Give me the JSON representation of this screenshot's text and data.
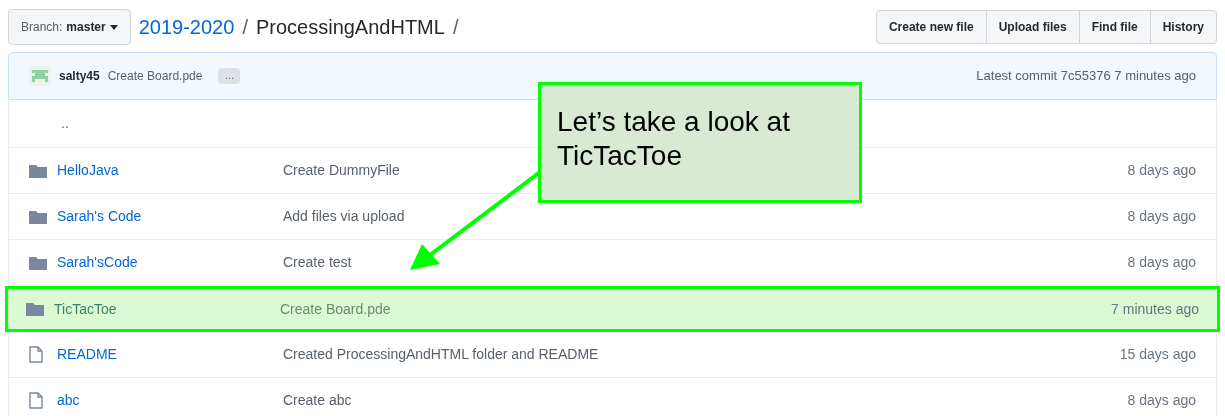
{
  "branch": {
    "label": "Branch:",
    "value": "master"
  },
  "breadcrumb": {
    "parent": "2019-2020",
    "current": "ProcessingAndHTML",
    "separator": "/"
  },
  "actions": [
    "Create new file",
    "Upload files",
    "Find file",
    "History"
  ],
  "commit": {
    "author": "salty45",
    "message": "Create Board.pde",
    "more": "…",
    "latest": "Latest commit 7c55376 7 minutes ago"
  },
  "parent_link": "..",
  "files": [
    {
      "kind": "folder",
      "name": "HelloJava",
      "message": "Create DummyFile",
      "age": "8 days ago",
      "highlighted": false
    },
    {
      "kind": "folder",
      "name": "Sarah's Code",
      "message": "Add files via upload",
      "age": "8 days ago",
      "highlighted": false
    },
    {
      "kind": "folder",
      "name": "Sarah'sCode",
      "message": "Create test",
      "age": "8 days ago",
      "highlighted": false
    },
    {
      "kind": "folder",
      "name": "TicTacToe",
      "message": "Create Board.pde",
      "age": "7 minutes ago",
      "highlighted": true
    },
    {
      "kind": "file",
      "name": "README",
      "message": "Created ProcessingAndHTML folder and README",
      "age": "15 days ago",
      "highlighted": false
    },
    {
      "kind": "file",
      "name": "abc",
      "message": "Create abc",
      "age": "8 days ago",
      "highlighted": false
    }
  ],
  "callout": {
    "text": "Let’s take a look at TicTacToe"
  }
}
